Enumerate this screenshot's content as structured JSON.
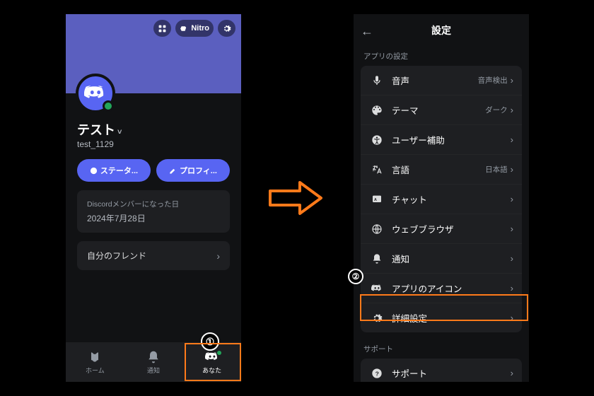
{
  "left": {
    "nitro": "Nitro",
    "display_name": "テスト",
    "user_tag": "test_1129",
    "status_btn": "ステータ...",
    "profile_btn": "プロフィ...",
    "member_since_label": "Discordメンバーになった日",
    "member_since_value": "2024年7月28日",
    "friends_row": "自分のフレンド",
    "nav": {
      "home": "ホーム",
      "notif": "通知",
      "you": "あなた"
    }
  },
  "right": {
    "title": "設定",
    "section_app": "アプリの設定",
    "section_support": "サポート",
    "items": {
      "voice": {
        "label": "音声",
        "hint": "音声検出"
      },
      "theme": {
        "label": "テーマ",
        "hint": "ダーク"
      },
      "access": {
        "label": "ユーザー補助",
        "hint": ""
      },
      "lang": {
        "label": "言語",
        "hint": "日本語"
      },
      "chat": {
        "label": "チャット",
        "hint": ""
      },
      "browser": {
        "label": "ウェブブラウザ",
        "hint": ""
      },
      "notif": {
        "label": "通知",
        "hint": ""
      },
      "appicon": {
        "label": "アプリのアイコン",
        "hint": ""
      },
      "adv": {
        "label": "詳細設定",
        "hint": ""
      },
      "support": {
        "label": "サポート",
        "hint": ""
      }
    }
  },
  "callouts": {
    "one": "①",
    "two": "②"
  }
}
